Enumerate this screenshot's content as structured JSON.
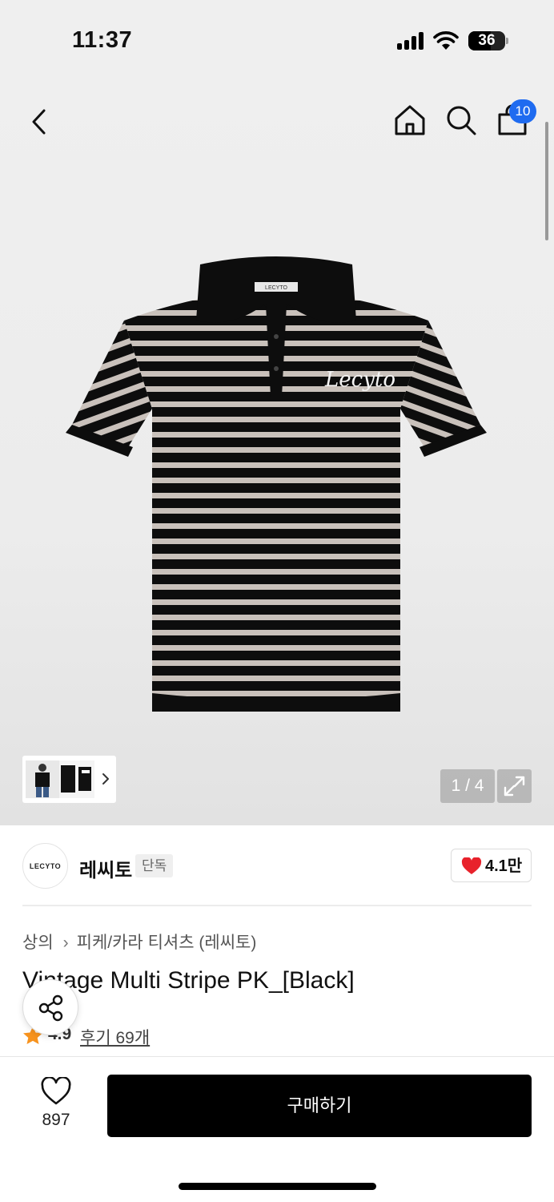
{
  "status_bar": {
    "time": "11:37",
    "battery": "36"
  },
  "nav": {
    "cart_count": "10"
  },
  "gallery": {
    "pager": "1 / 4"
  },
  "brand": {
    "logo_text": "LECYTO",
    "name": "레씨토",
    "tag": "단독",
    "likes": "4.1만"
  },
  "product": {
    "breadcrumb": [
      "상의",
      "피케/카라 티셔츠 (레씨토)"
    ],
    "title": "Vintage Multi Stripe PK_[Black]",
    "rating": "4.9",
    "reviews": "후기 69개"
  },
  "bottom_bar": {
    "wish_count": "897",
    "buy_label": "구매하기"
  },
  "colors": {
    "accent": "#1f6bf0",
    "heart": "#e8222b",
    "star": "#f7931e"
  }
}
